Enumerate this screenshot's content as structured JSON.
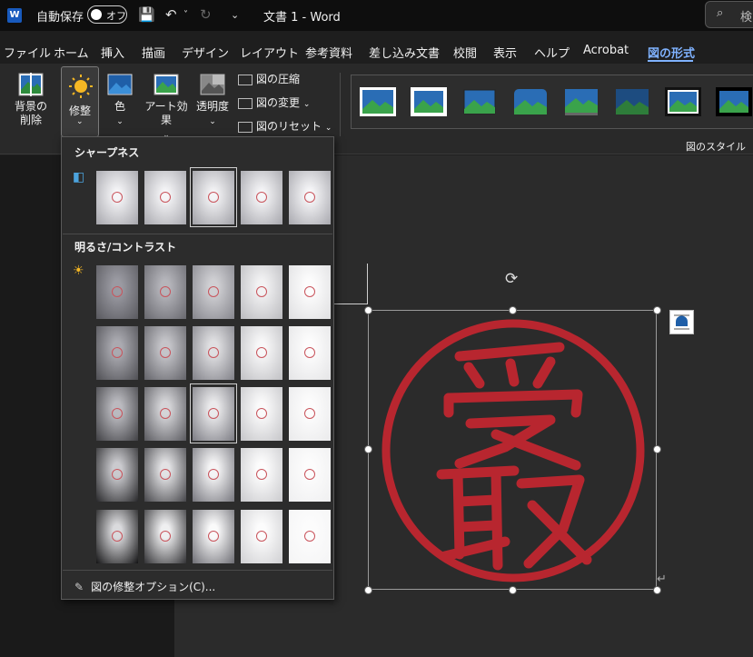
{
  "titlebar": {
    "autosave_label": "自動保存",
    "autosave_state": "オフ",
    "doc_title": "文書 1 - Word",
    "search_placeholder": "検"
  },
  "menu": [
    {
      "label": "ファイル"
    },
    {
      "label": "ホーム"
    },
    {
      "label": "挿入"
    },
    {
      "label": "描画"
    },
    {
      "label": "デザイン"
    },
    {
      "label": "レイアウト"
    },
    {
      "label": "参考資料"
    },
    {
      "label": "差し込み文書"
    },
    {
      "label": "校閲"
    },
    {
      "label": "表示"
    },
    {
      "label": "ヘルプ"
    },
    {
      "label": "Acrobat"
    },
    {
      "label": "図の形式",
      "active": true
    }
  ],
  "ribbon": {
    "remove_bg": [
      "背景の",
      "削除"
    ],
    "adjust": "修整",
    "color": "色",
    "artistic": "アート効果",
    "transparency": "透明度",
    "compress": "図の圧縮",
    "change": "図の変更",
    "reset": "図のリセット",
    "styles_group": "図のスタイル"
  },
  "dropdown": {
    "sharpness_heading": "シャープネス",
    "brightness_heading": "明るさ/コントラスト",
    "options_link": "図の修整オプション(C)...",
    "sharpness_selected_index": 2,
    "brightness_selected": [
      2,
      2
    ]
  },
  "colors": {
    "accent": "#7fb2ff",
    "stamp_red": "#b8262f",
    "background": "#1e1e1e"
  }
}
